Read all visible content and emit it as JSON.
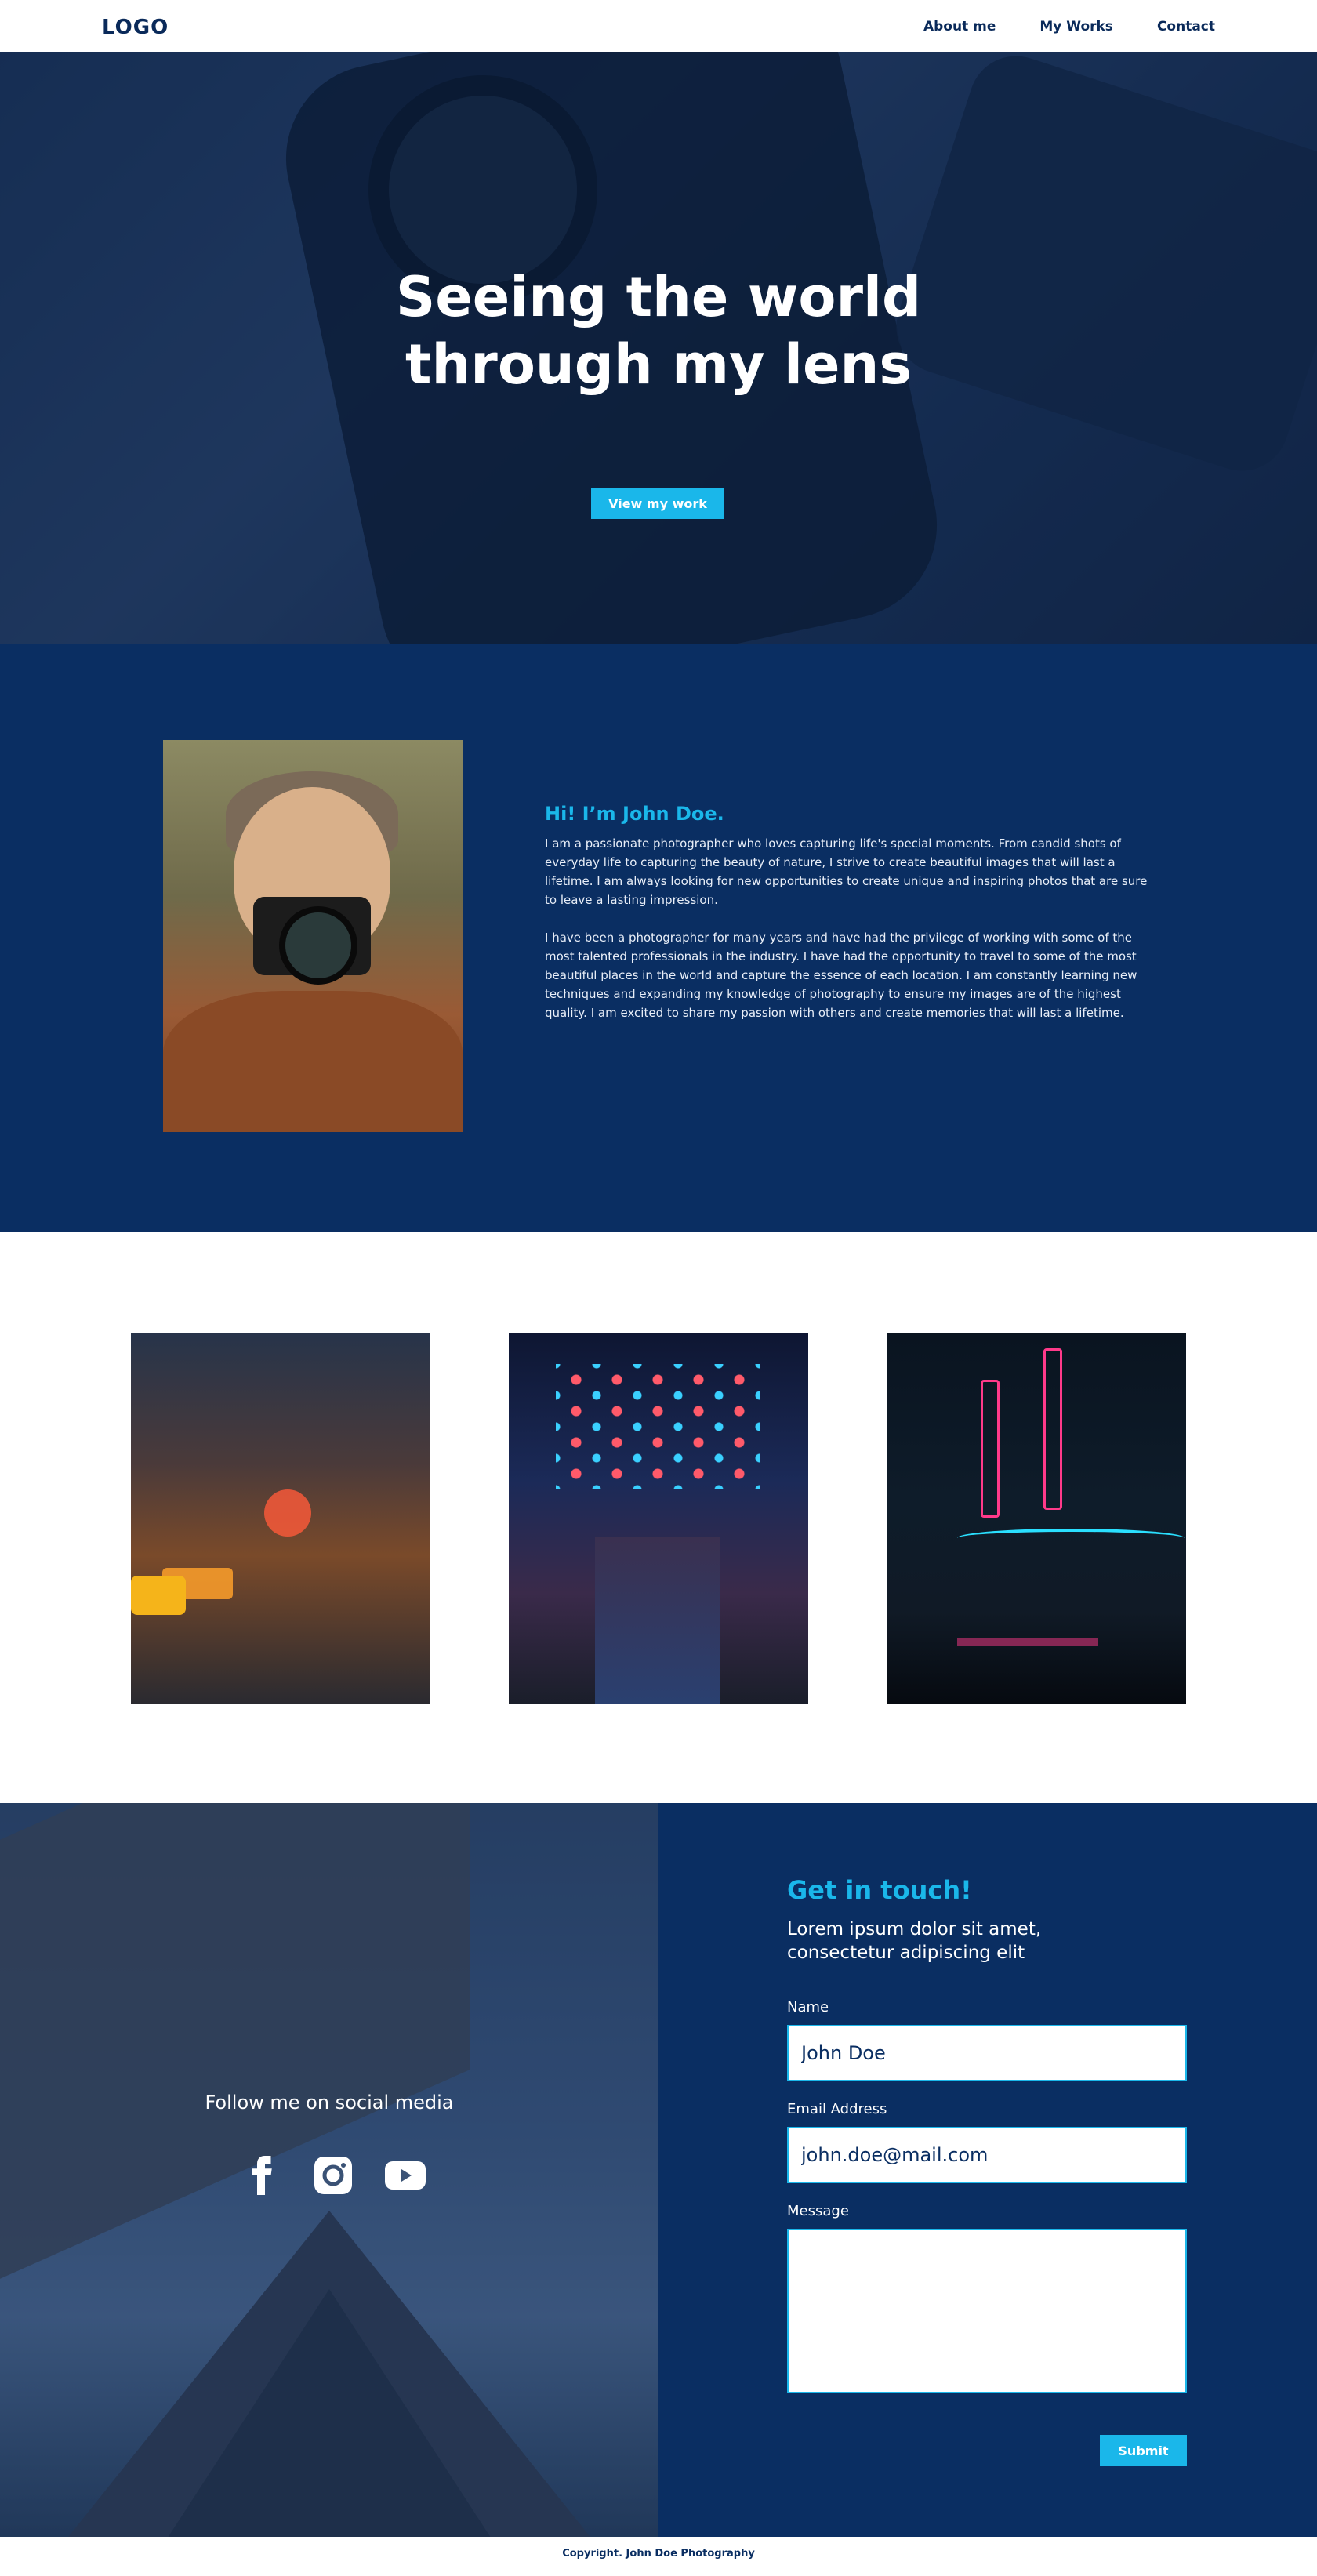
{
  "nav": {
    "logo": "LOGO",
    "links": [
      "About me",
      "My Works",
      "Contact"
    ]
  },
  "hero": {
    "title_line1": "Seeing the world",
    "title_line2": "through my lens",
    "button": "View my work"
  },
  "about": {
    "heading": "Hi! I’m John Doe.",
    "paragraph1": "I am a passionate photographer who loves capturing life's special moments. From candid shots of everyday life to capturing the beauty of nature, I strive to create beautiful images that will last a lifetime. I am always looking for new opportunities to create unique and inspiring photos that are sure to leave a lasting impression.",
    "paragraph2": "I have been a photographer for many years and have had the privilege of working with some of the most talented professionals in the industry. I have had the opportunity to travel to some of the most beautiful places in the world and capture the essence of each location. I am constantly learning new techniques and expanding my knowledge of photography to ensure my images are of the highest quality. I am excited to share my passion with others and create memories that will last a lifetime."
  },
  "social": {
    "heading": "Follow me on social media",
    "icons": [
      "facebook-icon",
      "instagram-icon",
      "youtube-icon"
    ]
  },
  "contact": {
    "title": "Get in touch!",
    "subtitle": "Lorem ipsum dolor sit amet, consectetur adipiscing elit",
    "name_label": "Name",
    "name_value": "John Doe",
    "email_label": "Email Address",
    "email_value": "john.doe@mail.com",
    "message_label": "Message",
    "message_value": "",
    "submit": "Submit"
  },
  "footer": {
    "copyright": "Copyright. John Doe Photography"
  },
  "colors": {
    "navy": "#0a2e62",
    "accent": "#1ab7ea",
    "white": "#ffffff"
  }
}
